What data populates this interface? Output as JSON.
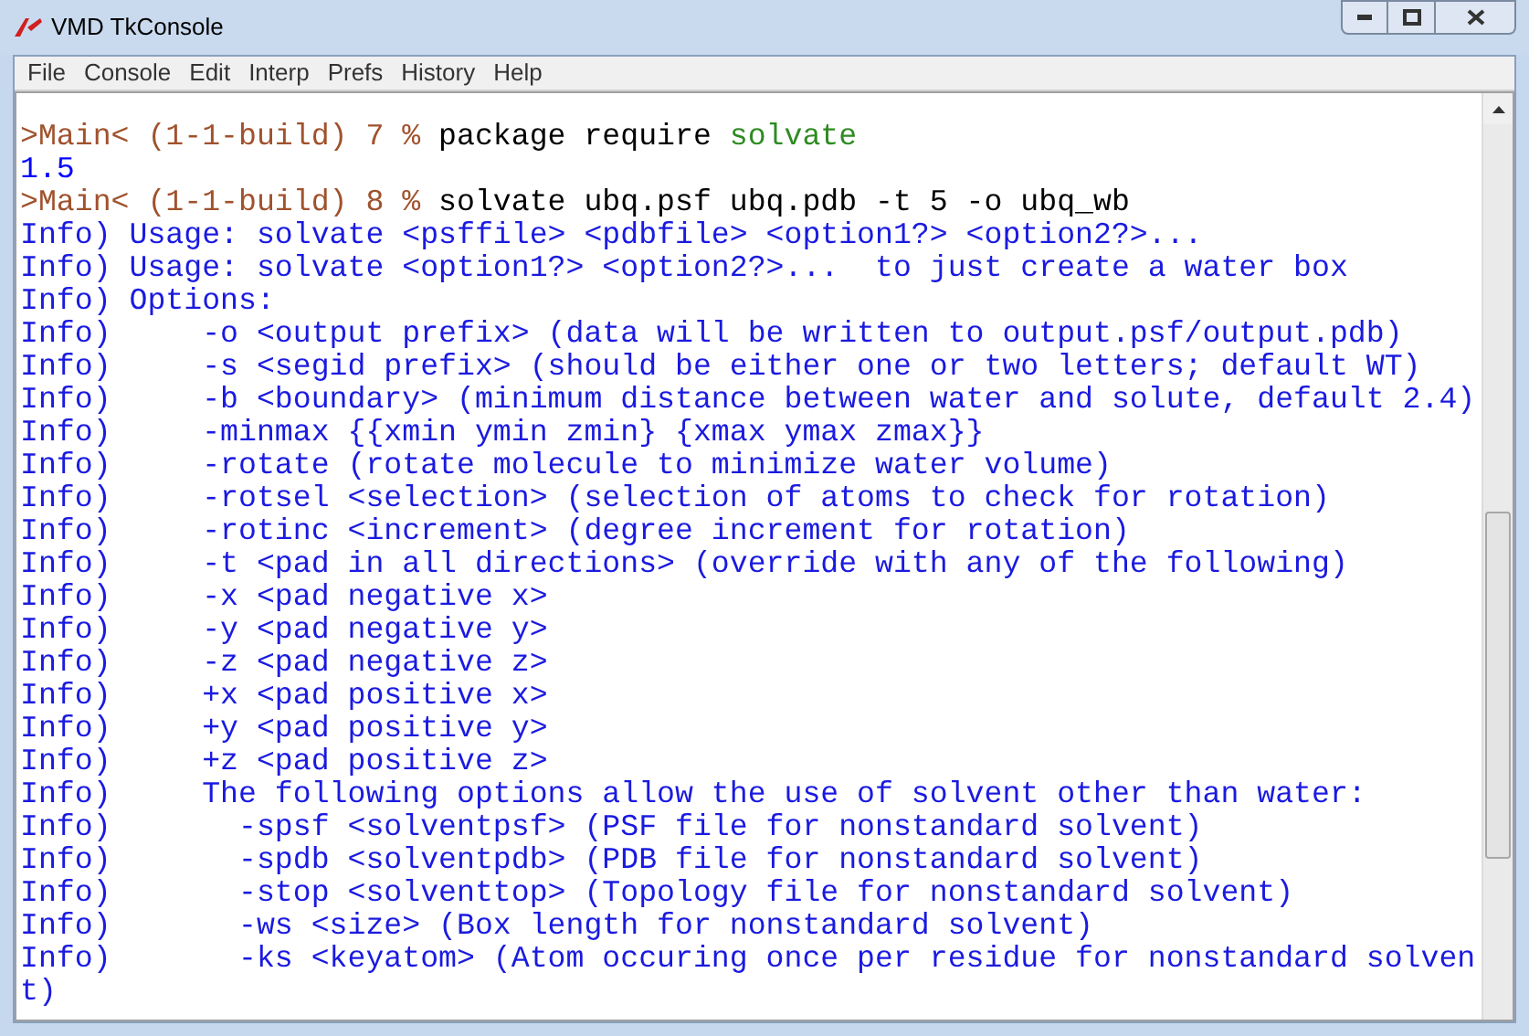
{
  "window": {
    "title": "VMD TkConsole"
  },
  "menu": [
    "File",
    "Console",
    "Edit",
    "Interp",
    "Prefs",
    "History",
    "Help"
  ],
  "console": {
    "lines": [
      {
        "segments": [
          {
            "kind": "prompt",
            "text": ">Main< (1-1-build) 7 % "
          },
          {
            "kind": "command",
            "text": "package require "
          },
          {
            "kind": "keyword",
            "text": "solvate"
          }
        ]
      },
      {
        "segments": [
          {
            "kind": "result",
            "text": "1.5"
          }
        ]
      },
      {
        "segments": [
          {
            "kind": "prompt",
            "text": ">Main< (1-1-build) 8 % "
          },
          {
            "kind": "command",
            "text": "solvate ubq.psf ubq.pdb -t 5 -o ubq_wb"
          }
        ]
      },
      {
        "segments": [
          {
            "kind": "info",
            "text": "Info) Usage: solvate <psffile> <pdbfile> <option1?> <option2?>..."
          }
        ]
      },
      {
        "segments": [
          {
            "kind": "info",
            "text": "Info) Usage: solvate <option1?> <option2?>...  to just create a water box"
          }
        ]
      },
      {
        "segments": [
          {
            "kind": "info",
            "text": "Info) Options:"
          }
        ]
      },
      {
        "segments": [
          {
            "kind": "info",
            "text": "Info)     -o <output prefix> (data will be written to output.psf/output.pdb)"
          }
        ]
      },
      {
        "segments": [
          {
            "kind": "info",
            "text": "Info)     -s <segid prefix> (should be either one or two letters; default WT)"
          }
        ]
      },
      {
        "segments": [
          {
            "kind": "info",
            "text": "Info)     -b <boundary> (minimum distance between water and solute, default 2.4)"
          }
        ]
      },
      {
        "segments": [
          {
            "kind": "info",
            "text": "Info)     -minmax {{xmin ymin zmin} {xmax ymax zmax}}"
          }
        ]
      },
      {
        "segments": [
          {
            "kind": "info",
            "text": "Info)     -rotate (rotate molecule to minimize water volume)"
          }
        ]
      },
      {
        "segments": [
          {
            "kind": "info",
            "text": "Info)     -rotsel <selection> (selection of atoms to check for rotation)"
          }
        ]
      },
      {
        "segments": [
          {
            "kind": "info",
            "text": "Info)     -rotinc <increment> (degree increment for rotation)"
          }
        ]
      },
      {
        "segments": [
          {
            "kind": "info",
            "text": "Info)     -t <pad in all directions> (override with any of the following)"
          }
        ]
      },
      {
        "segments": [
          {
            "kind": "info",
            "text": "Info)     -x <pad negative x>"
          }
        ]
      },
      {
        "segments": [
          {
            "kind": "info",
            "text": "Info)     -y <pad negative y>"
          }
        ]
      },
      {
        "segments": [
          {
            "kind": "info",
            "text": "Info)     -z <pad negative z>"
          }
        ]
      },
      {
        "segments": [
          {
            "kind": "info",
            "text": "Info)     +x <pad positive x>"
          }
        ]
      },
      {
        "segments": [
          {
            "kind": "info",
            "text": "Info)     +y <pad positive y>"
          }
        ]
      },
      {
        "segments": [
          {
            "kind": "info",
            "text": "Info)     +z <pad positive z>"
          }
        ]
      },
      {
        "segments": [
          {
            "kind": "info",
            "text": "Info)     The following options allow the use of solvent other than water:"
          }
        ]
      },
      {
        "segments": [
          {
            "kind": "info",
            "text": "Info)       -spsf <solventpsf> (PSF file for nonstandard solvent)"
          }
        ]
      },
      {
        "segments": [
          {
            "kind": "info",
            "text": "Info)       -spdb <solventpdb> (PDB file for nonstandard solvent)"
          }
        ]
      },
      {
        "segments": [
          {
            "kind": "info",
            "text": "Info)       -stop <solventtop> (Topology file for nonstandard solvent)"
          }
        ]
      },
      {
        "segments": [
          {
            "kind": "info",
            "text": "Info)       -ws <size> (Box length for nonstandard solvent)"
          }
        ]
      },
      {
        "segments": [
          {
            "kind": "info",
            "text": "Info)       -ks <keyatom> (Atom occuring once per residue for nonstandard solven"
          }
        ]
      },
      {
        "segments": [
          {
            "kind": "info",
            "text": "t)"
          }
        ]
      }
    ]
  }
}
